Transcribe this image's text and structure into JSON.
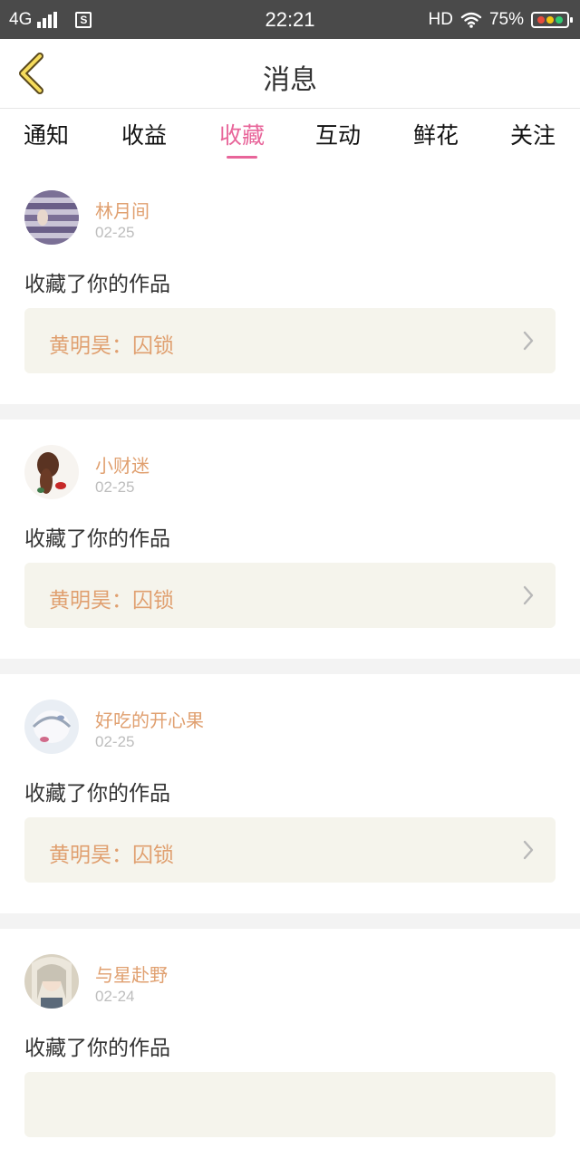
{
  "status_bar": {
    "network": "4G",
    "time": "22:21",
    "hd": "HD",
    "battery": "75%"
  },
  "header": {
    "title": "消息"
  },
  "tabs": [
    {
      "label": "通知"
    },
    {
      "label": "收益"
    },
    {
      "label": "收藏",
      "active": true
    },
    {
      "label": "互动"
    },
    {
      "label": "鲜花"
    },
    {
      "label": "关注"
    }
  ],
  "messages": [
    {
      "user": "林月间",
      "date": "02-25",
      "action": "收藏了你的作品",
      "work": "黄明昊：囚锁"
    },
    {
      "user": "小财迷",
      "date": "02-25",
      "action": "收藏了你的作品",
      "work": "黄明昊：囚锁"
    },
    {
      "user": "好吃的开心果",
      "date": "02-25",
      "action": "收藏了你的作品",
      "work": "黄明昊：囚锁"
    },
    {
      "user": "与星赴野",
      "date": "02-24",
      "action": "收藏了你的作品",
      "work": ""
    }
  ],
  "colors": {
    "accent": "#e8659a",
    "username": "#e0a070",
    "card_bg": "#f5f4ec"
  }
}
